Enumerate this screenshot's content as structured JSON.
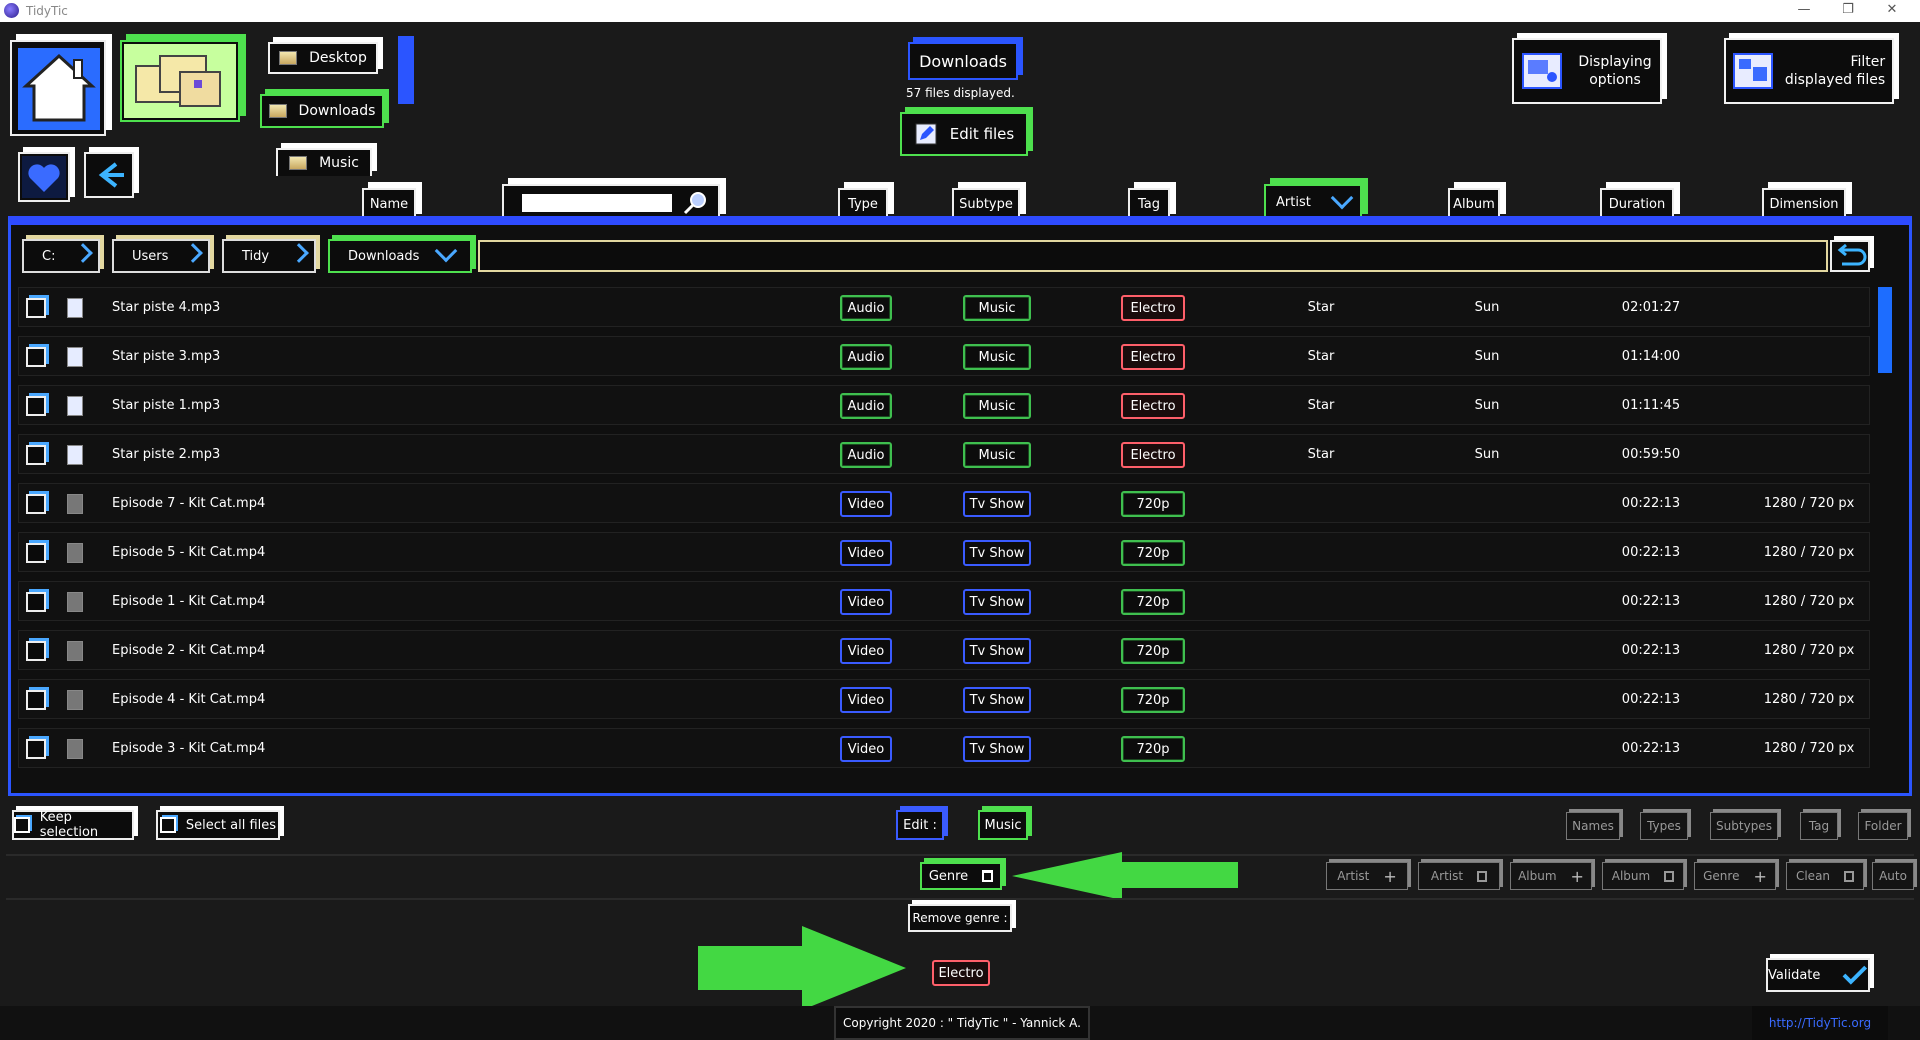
{
  "app": {
    "title": "TidyTic"
  },
  "nav": {
    "shortcuts": [
      "Desktop",
      "Downloads",
      "Music"
    ]
  },
  "header": {
    "current_folder": "Downloads",
    "files_count": "57 files displayed.",
    "edit_files": "Edit files",
    "displaying_options": [
      "Displaying",
      "options"
    ],
    "filter_files": [
      "Filter",
      "displayed files"
    ]
  },
  "columns": [
    "Name",
    "Type",
    "Subtype",
    "Tag",
    "Artist",
    "Album",
    "Duration",
    "Dimension"
  ],
  "search": {
    "value": ""
  },
  "breadcrumb": [
    "C:",
    "Users",
    "Tidy",
    "Downloads"
  ],
  "rows": [
    {
      "name": "Star piste 4.mp3",
      "type": "Audio",
      "subtype": "Music",
      "tag": "Electro",
      "artist": "Star",
      "album": "Sun",
      "duration": "02:01:27",
      "dimension": ""
    },
    {
      "name": "Star piste 3.mp3",
      "type": "Audio",
      "subtype": "Music",
      "tag": "Electro",
      "artist": "Star",
      "album": "Sun",
      "duration": "01:14:00",
      "dimension": ""
    },
    {
      "name": "Star piste 1.mp3",
      "type": "Audio",
      "subtype": "Music",
      "tag": "Electro",
      "artist": "Star",
      "album": "Sun",
      "duration": "01:11:45",
      "dimension": ""
    },
    {
      "name": "Star piste 2.mp3",
      "type": "Audio",
      "subtype": "Music",
      "tag": "Electro",
      "artist": "Star",
      "album": "Sun",
      "duration": "00:59:50",
      "dimension": ""
    },
    {
      "name": "Episode 7 - Kit Cat.mp4",
      "type": "Video",
      "subtype": "Tv Show",
      "tag": "720p",
      "artist": "",
      "album": "",
      "duration": "00:22:13",
      "dimension": "1280 / 720 px"
    },
    {
      "name": "Episode 5 - Kit Cat.mp4",
      "type": "Video",
      "subtype": "Tv Show",
      "tag": "720p",
      "artist": "",
      "album": "",
      "duration": "00:22:13",
      "dimension": "1280 / 720 px"
    },
    {
      "name": "Episode 1 - Kit Cat.mp4",
      "type": "Video",
      "subtype": "Tv Show",
      "tag": "720p",
      "artist": "",
      "album": "",
      "duration": "00:22:13",
      "dimension": "1280 / 720 px"
    },
    {
      "name": "Episode 2 - Kit Cat.mp4",
      "type": "Video",
      "subtype": "Tv Show",
      "tag": "720p",
      "artist": "",
      "album": "",
      "duration": "00:22:13",
      "dimension": "1280 / 720 px"
    },
    {
      "name": "Episode 4 - Kit Cat.mp4",
      "type": "Video",
      "subtype": "Tv Show",
      "tag": "720p",
      "artist": "",
      "album": "",
      "duration": "00:22:13",
      "dimension": "1280 / 720 px"
    },
    {
      "name": "Episode 3 - Kit Cat.mp4",
      "type": "Video",
      "subtype": "Tv Show",
      "tag": "720p",
      "artist": "",
      "album": "",
      "duration": "00:22:13",
      "dimension": "1280 / 720 px"
    }
  ],
  "bottom": {
    "keep_selection": "Keep selection",
    "select_all": "Select all files",
    "edit_label": "Edit :",
    "edit_value": "Music",
    "right_tabs": [
      "Names",
      "Types",
      "Subtypes",
      "Tag",
      "Folder"
    ],
    "genre_btn": "Genre",
    "action_btns": [
      "Artist",
      "Artist",
      "Album",
      "Album",
      "Genre",
      "Clean",
      "Auto"
    ],
    "remove_genre": "Remove genre :",
    "genre_value": "Electro",
    "validate": "Validate"
  },
  "footer": {
    "copyright": "Copyright 2020 : \" TidyTic \" - Yannick A.",
    "link": "http://TidyTic.org"
  },
  "colors": {
    "accent_blue": "#2b55ff",
    "accent_green": "#4ee04e",
    "tag_red": "#ff5f6a",
    "arrow_green": "#43d843"
  }
}
